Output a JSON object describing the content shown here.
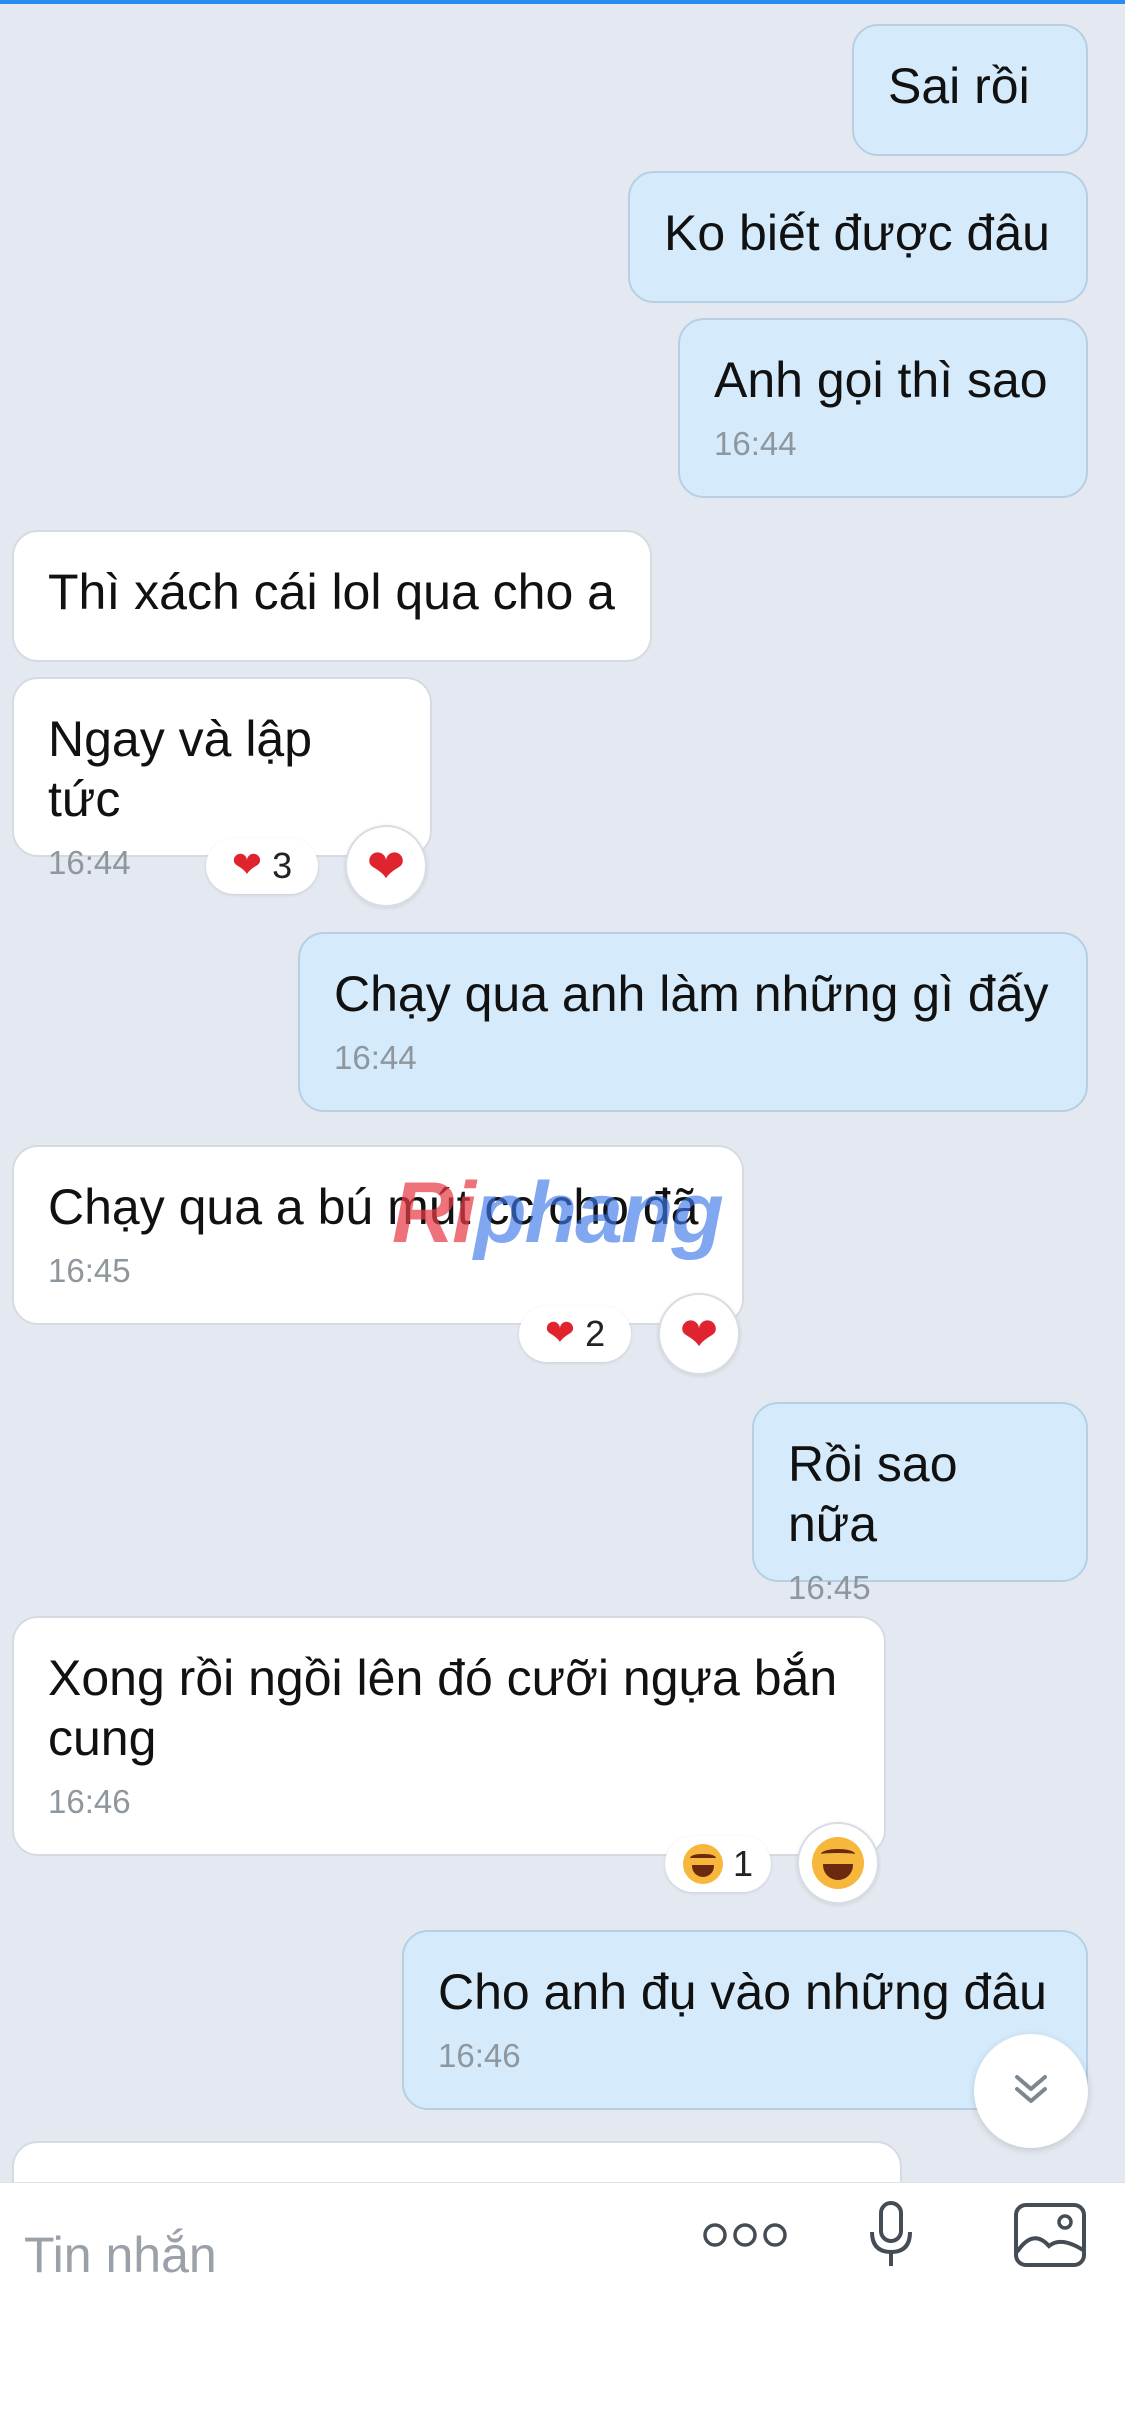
{
  "messages": [
    {
      "dir": "out",
      "text": "Sai rồi",
      "time": ""
    },
    {
      "dir": "out",
      "text": "Ko biết được đâu",
      "time": ""
    },
    {
      "dir": "out",
      "text": "Anh gọi thì sao",
      "time": "16:44"
    },
    {
      "dir": "in",
      "text": "Thì xách cái lol qua cho a",
      "time": ""
    },
    {
      "dir": "in",
      "text": "Ngay và lập tức",
      "time": "16:44"
    },
    {
      "dir": "out",
      "text": "Chạy qua anh làm những gì đấy",
      "time": "16:44"
    },
    {
      "dir": "in",
      "text": "Chạy qua a bú mút cc cho đã",
      "time": "16:45"
    },
    {
      "dir": "out",
      "text": "Rồi sao nữa",
      "time": "16:45"
    },
    {
      "dir": "in",
      "text": "Xong rồi ngồi lên đó cưỡi ngựa bắn cung",
      "time": "16:46"
    },
    {
      "dir": "out",
      "text": "Cho anh đụ vào những đâu",
      "time": "16:46"
    },
    {
      "dir": "in",
      "text": "",
      "time": ""
    }
  ],
  "reactions": [
    {
      "message_index": 4,
      "emoji": "heart",
      "glyph": "❤",
      "count": "3"
    },
    {
      "message_index": 6,
      "emoji": "heart",
      "glyph": "❤",
      "count": "2"
    },
    {
      "message_index": 8,
      "emoji": "laughing-face",
      "glyph": "",
      "count": "1"
    }
  ],
  "watermark": {
    "accent": "Ri",
    "rest": "phang"
  },
  "composer": {
    "placeholder": "Tin nhắn"
  },
  "icons": {
    "more": "more-dots-icon",
    "mic": "microphone-icon",
    "image": "image-icon",
    "scroll": "scroll-down-icon"
  },
  "colors": {
    "outgoing_bubble": "#d5ebfb",
    "incoming_bubble": "#ffffff",
    "background": "#e4e8f0",
    "heart": "#e0242f",
    "timestamp": "#8e969e"
  }
}
